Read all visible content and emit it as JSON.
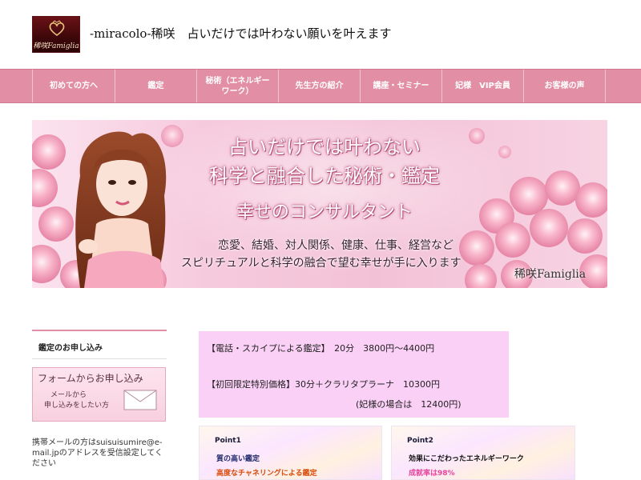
{
  "header": {
    "logo_text": "稀咲Famiglia",
    "title": "-miracolo-稀咲　占いだけでは叶わない願いを叶えます"
  },
  "nav": {
    "items": [
      {
        "label": "初めての方へ"
      },
      {
        "label": "鑑定"
      },
      {
        "label": "秘術（エネルギーワーク）"
      },
      {
        "label": "先生方の紹介"
      },
      {
        "label": "講座・セミナー"
      },
      {
        "label": "妃様　VIP会員"
      },
      {
        "label": "お客様の声"
      }
    ]
  },
  "banner": {
    "line1": "占いだけでは叶わない",
    "line2": "科学と融合した秘術・鑑定",
    "line3": "幸せのコンサルタント",
    "sub1": "恋愛、結婚、対人関係、健康、仕事、経営など",
    "sub2": "スピリチュアルと科学の融合で望む幸せが手に入ります",
    "brand": "稀咲Famiglia"
  },
  "sidebar": {
    "heading": "鑑定のお申し込み",
    "form_banner": {
      "title": "フォームからお申し込み",
      "line1": "メールから",
      "line2": "申し込みをしたい方"
    },
    "note": "携帯メールの方はsuisuisumire@e-mail.jpのアドレスを受信設定してください"
  },
  "pricing": {
    "line1": "【電話・スカイプによる鑑定】　20分　3800円〜4400円",
    "line2": "【初回限定特別価格】30分＋クラリタプラーナ　10300円",
    "line3": "(妃様の場合は　12400円)"
  },
  "points": [
    {
      "label": "Point1",
      "line1": "質の高い鑑定",
      "line2": "高度なチャネリングによる鑑定"
    },
    {
      "label": "Point2",
      "line1": "効果にこだわったエネルギーワーク",
      "line2": "成就率は98%"
    }
  ],
  "colors": {
    "nav_bg": "#e28fa6",
    "price_box_bg": "#fbd0f6",
    "accent_pink": "#e28fa6"
  }
}
